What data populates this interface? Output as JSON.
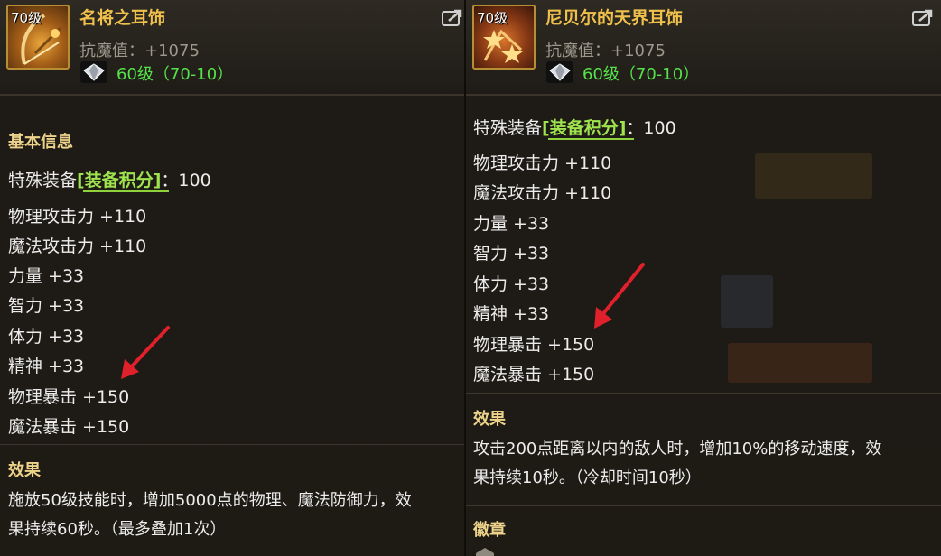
{
  "left": {
    "level": "70级",
    "name": "名将之耳饰",
    "resist": "抗魔值：+1075",
    "requirement": "60级（70-10）",
    "section_basic": "基本信息",
    "special_prefix": "特殊装备",
    "special_tag": "[装备积分]",
    "special_suffix": "：100",
    "stats": [
      "物理攻击力 +110",
      "魔法攻击力 +110",
      "力量 +33",
      "智力 +33",
      "体力 +33",
      "精神 +33",
      "物理暴击 +150",
      "魔法暴击 +150"
    ],
    "effect_title": "效果",
    "effect_line1": "施放50级技能时，增加5000点的物理、魔法防御力，效",
    "effect_line2": "果持续60秒。（最多叠加1次）"
  },
  "right": {
    "level": "70级",
    "name": "尼贝尔的天界耳饰",
    "resist": "抗魔值：+1075",
    "requirement": "60级（70-10）",
    "special_prefix": "特殊装备",
    "special_tag": "[装备积分]",
    "special_suffix": "：100",
    "stats": [
      "物理攻击力 +110",
      "魔法攻击力 +110",
      "力量 +33",
      "智力 +33",
      "体力 +33",
      "精神 +33",
      "物理暴击 +150",
      "魔法暴击 +150"
    ],
    "effect_title": "效果",
    "effect_line1": "攻击200点距离以内的敌人时，增加10%的移动速度，效",
    "effect_line2": "果持续10秒。（冷却时间10秒）",
    "emblem_title": "徽章"
  },
  "colors": {
    "name": "#f0c04c",
    "requirement": "#56e24a",
    "tag": "#9fe34e",
    "arrow": "#e0202a"
  }
}
